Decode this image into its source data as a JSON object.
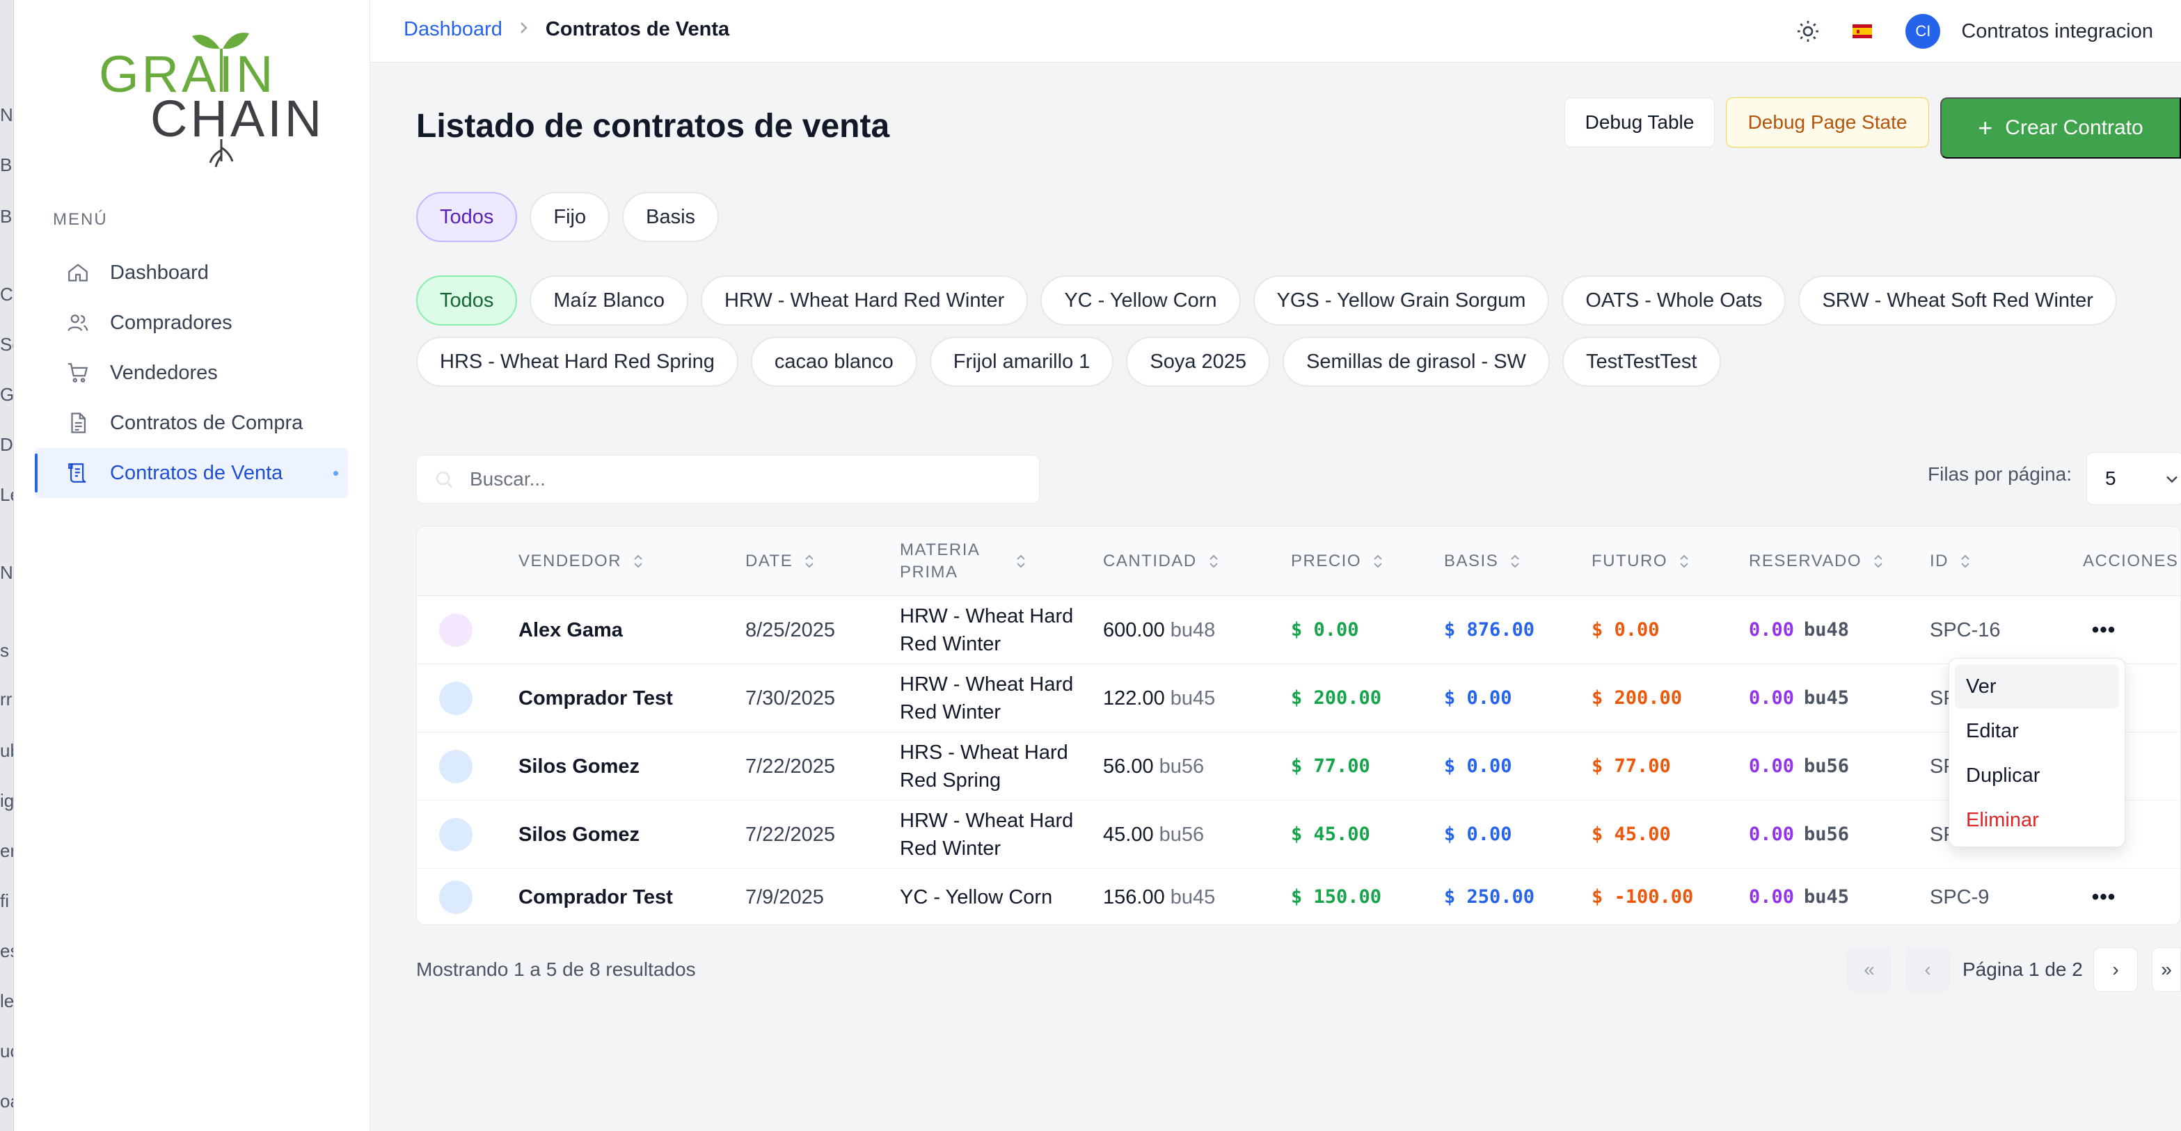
{
  "background_window": {
    "fragments": [
      "Nu",
      "Bu",
      "Bil",
      "Co",
      "So",
      "GF",
      "DA",
      "Le",
      "Nu",
      "s",
      "rr",
      "ub",
      "ig",
      "er",
      "fi",
      "es",
      "le",
      "uc",
      "oa"
    ]
  },
  "sidebar": {
    "logo_text_top": "GRAIN",
    "logo_text_bottom": "CHAIN",
    "menu_title": "MENÚ",
    "items": [
      {
        "label": "Dashboard",
        "icon": "home-icon"
      },
      {
        "label": "Compradores",
        "icon": "users-icon"
      },
      {
        "label": "Vendedores",
        "icon": "cart-icon"
      },
      {
        "label": "Contratos de Compra",
        "icon": "document-icon"
      },
      {
        "label": "Contratos de Venta",
        "icon": "scroll-icon",
        "active": true
      }
    ]
  },
  "topbar": {
    "breadcrumb": {
      "parent": "Dashboard",
      "current": "Contratos de Venta"
    },
    "avatar_initials": "CI",
    "user_name": "Contratos integracion",
    "language_flag": "es"
  },
  "page": {
    "title": "Listado de contratos de venta",
    "debug_table_label": "Debug Table",
    "debug_state_label": "Debug Page State",
    "create_label": "Crear Contrato"
  },
  "type_filters": [
    "Todos",
    "Fijo",
    "Basis"
  ],
  "commodity_filters_row1": [
    "Todos",
    "Maíz Blanco",
    "HRW - Wheat Hard Red Winter",
    "YC - Yellow Corn",
    "YGS - Yellow Grain Sorgum",
    "OATS - Whole Oats",
    "SRW - Wheat Soft Red Winter"
  ],
  "commodity_filters_row2": [
    "HRS - Wheat Hard Red Spring",
    "cacao blanco",
    "Frijol amarillo 1",
    "Soya 2025",
    "Semillas de girasol - SW",
    "TestTestTest"
  ],
  "search": {
    "placeholder": "Buscar..."
  },
  "rows_per_page": {
    "label": "Filas por página:",
    "value": "5"
  },
  "table": {
    "headers": {
      "vendedor": "VENDEDOR",
      "date": "DATE",
      "materia": "MATERIA PRIMA",
      "cantidad": "CANTIDAD",
      "precio": "PRECIO",
      "basis": "BASIS",
      "futuro": "FUTURO",
      "reservado": "RESERVADO",
      "id": "ID",
      "acciones": "ACCIONES"
    },
    "rows": [
      {
        "vendedor": "Alex Gama",
        "date": "8/25/2025",
        "materia": "HRW - Wheat Hard Red Winter",
        "cantidad": "600.00",
        "cantidad_unit": "bu48",
        "precio": "$ 0.00",
        "basis": "$ 876.00",
        "futuro": "$ 0.00",
        "reservado": "0.00",
        "reservado_unit": "bu48",
        "id": "SPC-16"
      },
      {
        "vendedor": "Comprador Test",
        "date": "7/30/2025",
        "materia": "HRW - Wheat Hard Red Winter",
        "cantidad": "122.00",
        "cantidad_unit": "bu45",
        "precio": "$ 200.00",
        "basis": "$ 0.00",
        "futuro": "$ 200.00",
        "reservado": "0.00",
        "reservado_unit": "bu45",
        "id": "SP"
      },
      {
        "vendedor": "Silos Gomez",
        "date": "7/22/2025",
        "materia": "HRS - Wheat Hard Red Spring",
        "cantidad": "56.00",
        "cantidad_unit": "bu56",
        "precio": "$ 77.00",
        "basis": "$ 0.00",
        "futuro": "$ 77.00",
        "reservado": "0.00",
        "reservado_unit": "bu56",
        "id": "SP"
      },
      {
        "vendedor": "Silos Gomez",
        "date": "7/22/2025",
        "materia": "HRW - Wheat Hard Red Winter",
        "cantidad": "45.00",
        "cantidad_unit": "bu56",
        "precio": "$ 45.00",
        "basis": "$ 0.00",
        "futuro": "$ 45.00",
        "reservado": "0.00",
        "reservado_unit": "bu56",
        "id": "SP"
      },
      {
        "vendedor": "Comprador Test",
        "date": "7/9/2025",
        "materia": "YC - Yellow Corn",
        "cantidad": "156.00",
        "cantidad_unit": "bu45",
        "precio": "$ 150.00",
        "basis": "$ 250.00",
        "futuro": "$ -100.00",
        "reservado": "0.00",
        "reservado_unit": "bu45",
        "id": "SPC-9"
      }
    ]
  },
  "row_menu": [
    "Ver",
    "Editar",
    "Duplicar",
    "Eliminar"
  ],
  "footer": {
    "showing": "Mostrando 1 a 5 de 8 resultados",
    "page_label": "Página 1 de 2",
    "first": "«",
    "prev": "‹",
    "next": "›",
    "last": "»"
  },
  "colors": {
    "primary": "#2563eb",
    "create_button": "#3ea34b",
    "precio": "#16a34a",
    "basis": "#2563eb",
    "futuro": "#ea580c",
    "reservado": "#9333ea",
    "danger": "#dc2626"
  }
}
